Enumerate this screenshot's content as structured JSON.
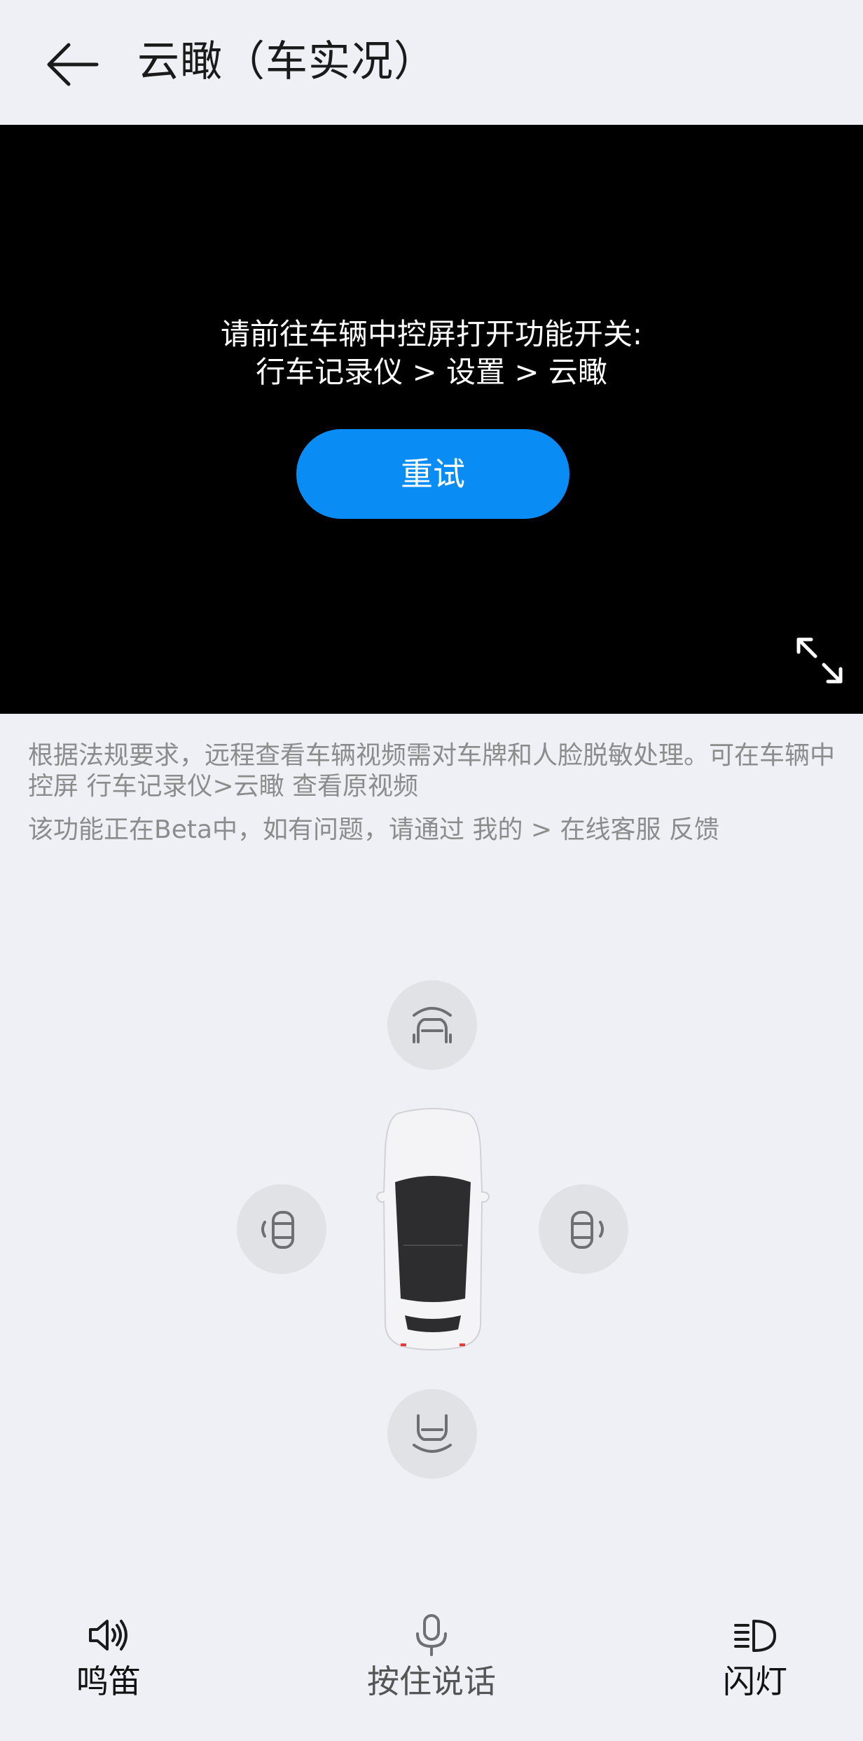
{
  "header": {
    "title": "云瞰（车实况）",
    "back_icon": "arrow-left-icon"
  },
  "video": {
    "message_line1": "请前往车辆中控屏打开功能开关:",
    "message_line2": "行车记录仪 > 设置 > 云瞰",
    "retry_label": "重试",
    "fullscreen_icon": "expand-icon",
    "accent_color": "#0a8cf5"
  },
  "notices": {
    "privacy": "根据法规要求，远程查看车辆视频需对车牌和人脸脱敏处理。可在车辆中控屏 行车记录仪>云瞰 查看原视频",
    "beta": "该功能正在Beta中，如有问题，请通过 我的 > 在线客服 反馈"
  },
  "cameras": {
    "front_icon": "front-camera-icon",
    "left_icon": "left-camera-icon",
    "right_icon": "right-camera-icon",
    "rear_icon": "rear-camera-icon"
  },
  "toolbar": {
    "horn_label": "鸣笛",
    "horn_icon": "speaker-icon",
    "talk_label": "按住说话",
    "talk_icon": "microphone-icon",
    "flash_label": "闪灯",
    "flash_icon": "headlight-icon"
  }
}
